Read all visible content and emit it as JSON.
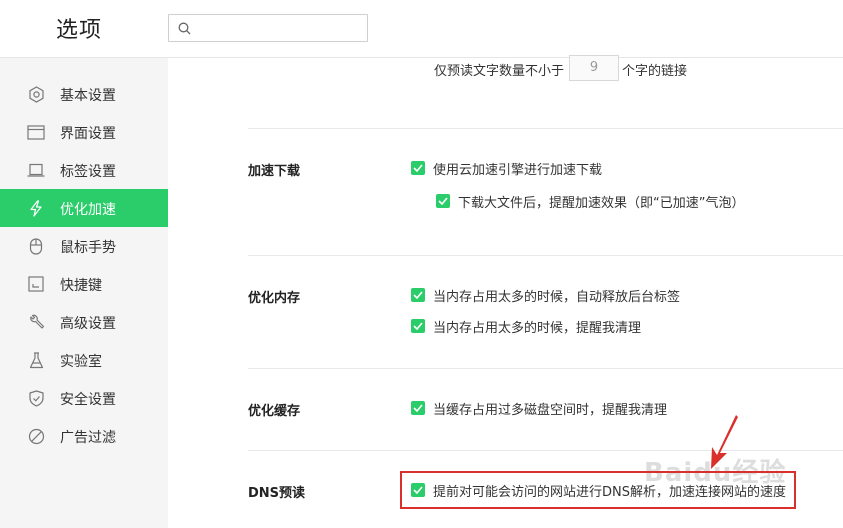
{
  "header": {
    "title": "选项",
    "search_placeholder": ""
  },
  "sidebar": {
    "items": [
      {
        "label": "基本设置",
        "icon": "gear-icon"
      },
      {
        "label": "界面设置",
        "icon": "window-icon"
      },
      {
        "label": "标签设置",
        "icon": "tab-icon"
      },
      {
        "label": "优化加速",
        "icon": "lightning-icon",
        "active": true
      },
      {
        "label": "鼠标手势",
        "icon": "mouse-icon"
      },
      {
        "label": "快捷键",
        "icon": "keyboard-icon"
      },
      {
        "label": "高级设置",
        "icon": "wrench-icon"
      },
      {
        "label": "实验室",
        "icon": "flask-icon"
      },
      {
        "label": "安全设置",
        "icon": "shield-icon"
      },
      {
        "label": "广告过滤",
        "icon": "block-icon"
      }
    ]
  },
  "preload": {
    "prefix": "仅预读文字数量不小于",
    "value": "9",
    "suffix": "个字的链接"
  },
  "sections": {
    "download": {
      "title": "加速下载",
      "opt1": "使用云加速引擎进行加速下载",
      "opt2": "下载大文件后，提醒加速效果（即“已加速”气泡）"
    },
    "memory": {
      "title": "优化内存",
      "opt1": "当内存占用太多的时候，自动释放后台标签",
      "opt2": "当内存占用太多的时候，提醒我清理"
    },
    "cache": {
      "title": "优化缓存",
      "opt1": "当缓存占用过多磁盘空间时，提醒我清理"
    },
    "dns": {
      "title": "DNS预读",
      "opt1": "提前对可能会访问的网站进行DNS解析，加速连接网站的速度"
    }
  },
  "watermark": "Baidu经验",
  "colors": {
    "accent": "#2bcc6a",
    "highlight": "#d9302b"
  }
}
